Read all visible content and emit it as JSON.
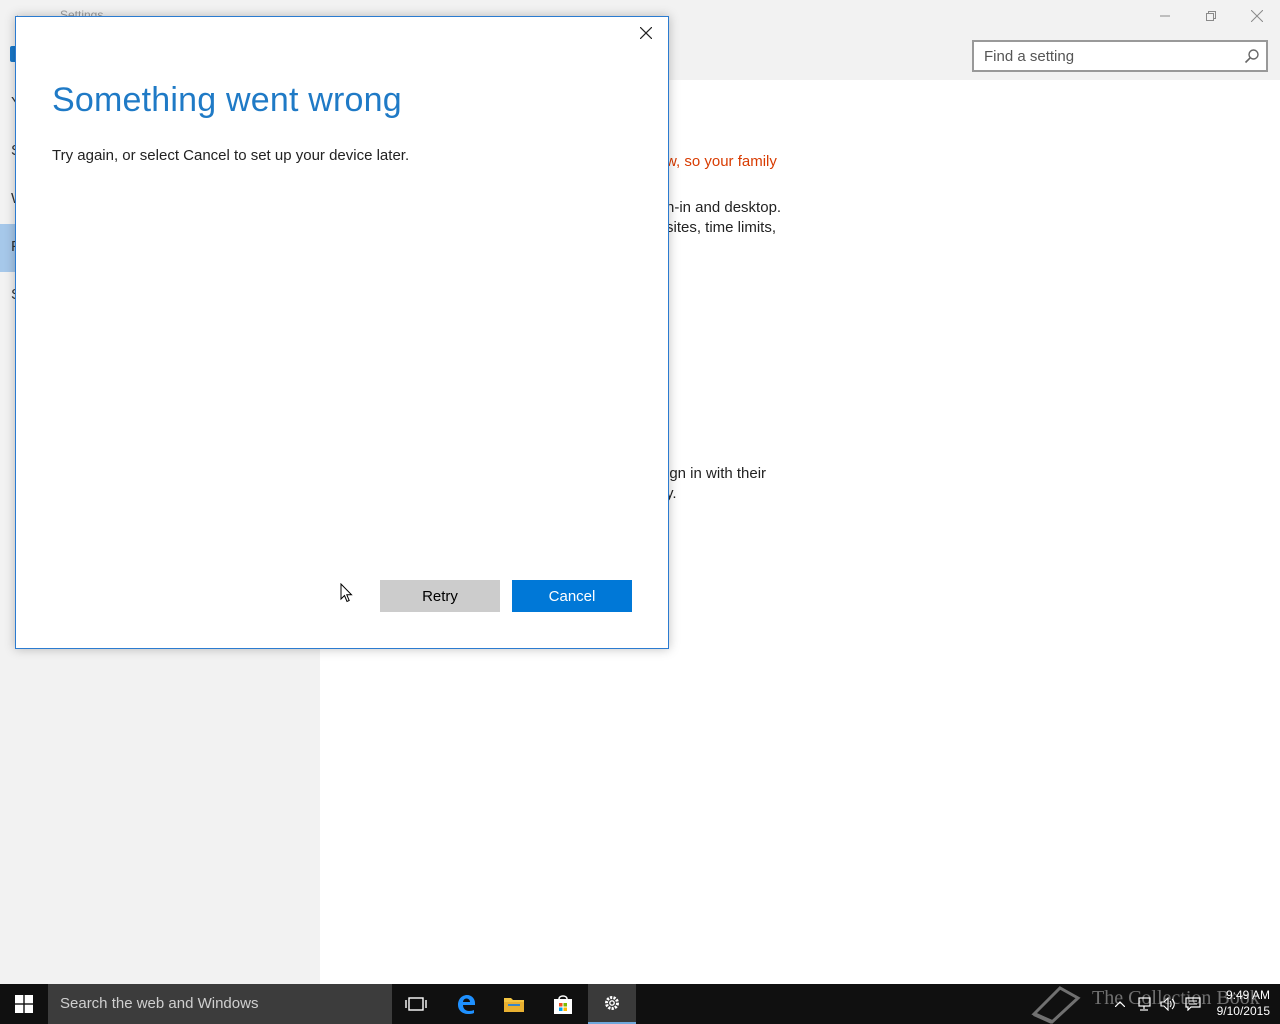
{
  "window": {
    "title": "Settings",
    "back_icon": "back-arrow-icon",
    "search_placeholder": "Find a setting"
  },
  "sidebar": {
    "items": [
      {
        "label": "Y"
      },
      {
        "label": "S"
      },
      {
        "label": "W"
      },
      {
        "label": "F"
      },
      {
        "label": "S"
      }
    ]
  },
  "content": {
    "line1": "w, so your family",
    "line2": "n-in and desktop.",
    "line3": "sites, time limits,",
    "line4": "ign in with their",
    "line5": "y."
  },
  "dialog": {
    "title": "Something went wrong",
    "message": "Try again, or select Cancel to set up your device later.",
    "retry_label": "Retry",
    "cancel_label": "Cancel"
  },
  "taskbar": {
    "search_text": "Search the web and Windows",
    "time": "9:49 AM",
    "date": "9/10/2015",
    "watermark": "The Collection Book"
  },
  "colors": {
    "accent": "#0078d7",
    "title_blue": "#1f7ac6",
    "warning_red": "#d83b01",
    "selected_item": "#a6c8ea"
  }
}
